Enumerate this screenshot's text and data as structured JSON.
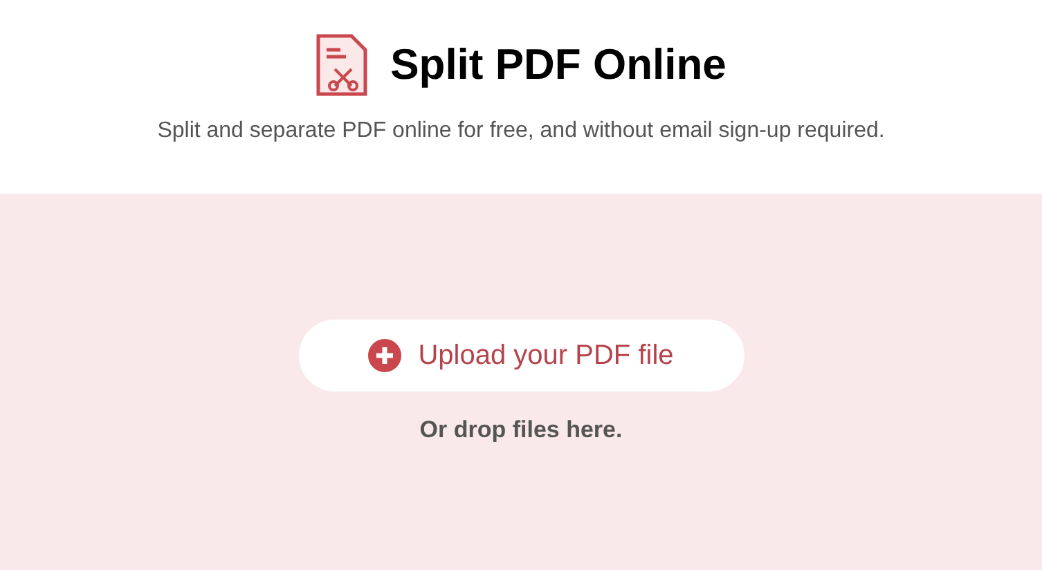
{
  "header": {
    "title": "Split PDF Online",
    "subtitle": "Split and separate PDF online for free, and without email sign-up required."
  },
  "dropzone": {
    "button": "Upload your PDF file",
    "hint": "Or drop files here."
  }
}
